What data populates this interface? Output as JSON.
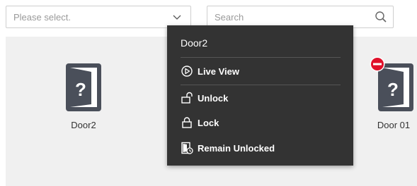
{
  "toolbar": {
    "select_placeholder": "Please select.",
    "search_placeholder": "Search"
  },
  "doors": [
    {
      "label": "Door2"
    },
    {
      "label": "Door 01"
    }
  ],
  "context_menu": {
    "title": "Door2",
    "items": [
      {
        "label": "Live View",
        "icon": "play-circle-icon"
      },
      {
        "label": "Unlock",
        "icon": "unlock-icon"
      },
      {
        "label": "Lock",
        "icon": "lock-icon"
      },
      {
        "label": "Remain Unlocked",
        "icon": "remain-unlocked-icon"
      }
    ]
  },
  "colors": {
    "menu_bg": "#333333",
    "door_icon": "#4a4f5a",
    "alert_red": "#e0102a",
    "panel_bg": "#f0f0f0"
  }
}
